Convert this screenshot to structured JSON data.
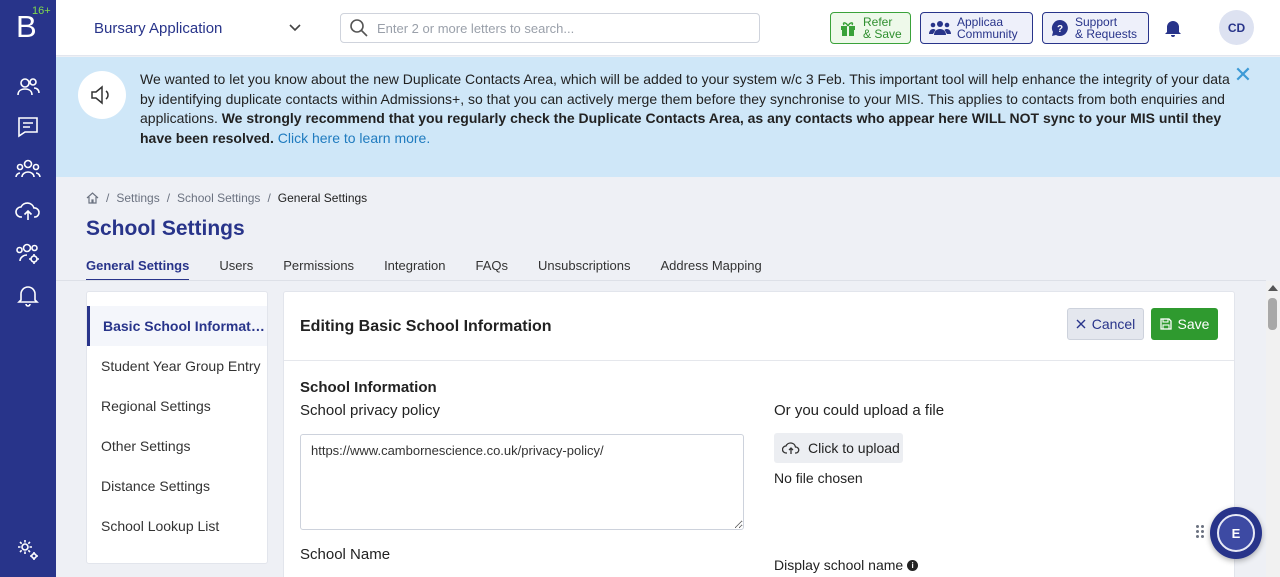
{
  "rail": {
    "logo_letter": "B",
    "logo_badge": "16+",
    "items": [
      "contacts-icon",
      "messages-icon",
      "groups-icon",
      "upload-icon",
      "user-settings-icon",
      "notifications-icon",
      "settings-icon"
    ]
  },
  "topbar": {
    "module": "Bursary Application",
    "search_placeholder": "Enter 2 or more letters to search...",
    "refer": {
      "line1": "Refer",
      "line2": "& Save"
    },
    "community": {
      "line1": "Applicaa",
      "line2": "Community"
    },
    "support": {
      "line1": "Support",
      "line2": "& Requests"
    },
    "avatar_initials": "CD"
  },
  "announcement": {
    "text": "We wanted to let you know about the new Duplicate Contacts Area, which will be added to your system w/c 3 Feb. This important tool will help enhance the integrity of your data by identifying duplicate contacts within Admissions+, so that you can actively merge them before they synchronise to your MIS. This applies to contacts from both enquiries and applications. ",
    "bold_text": "We strongly recommend that you regularly check the Duplicate Contacts Area, as any contacts who appear here WILL NOT sync to your MIS until they have been resolved.",
    "link_text": "Click here to learn more.",
    "close_symbol": "✕"
  },
  "breadcrumb": {
    "items": [
      "Settings",
      "School Settings"
    ],
    "current": "General Settings",
    "separator": "/"
  },
  "page": {
    "title": "School Settings",
    "tabs": [
      "General Settings",
      "Users",
      "Permissions",
      "Integration",
      "FAQs",
      "Unsubscriptions",
      "Address Mapping"
    ]
  },
  "sidemenu": {
    "items": [
      "Basic School Information",
      "Student Year Group Entry",
      "Regional Settings",
      "Other Settings",
      "Distance Settings",
      "School Lookup List"
    ]
  },
  "panel": {
    "title": "Editing Basic School Information",
    "cancel_label": "Cancel",
    "save_label": "Save",
    "section_title": "School Information",
    "privacy_label": "School privacy policy",
    "privacy_value": "https://www.cambornescience.co.uk/privacy-policy/",
    "upload_label": "Or you could upload a file",
    "upload_button": "Click to upload",
    "no_file": "No file chosen",
    "school_name_label": "School Name",
    "display_name_label": "Display school name"
  },
  "chat": {
    "initial": "E"
  },
  "colors": {
    "brand": "#28348a",
    "success": "#2f9a2f",
    "banner": "#cfe7f8"
  }
}
